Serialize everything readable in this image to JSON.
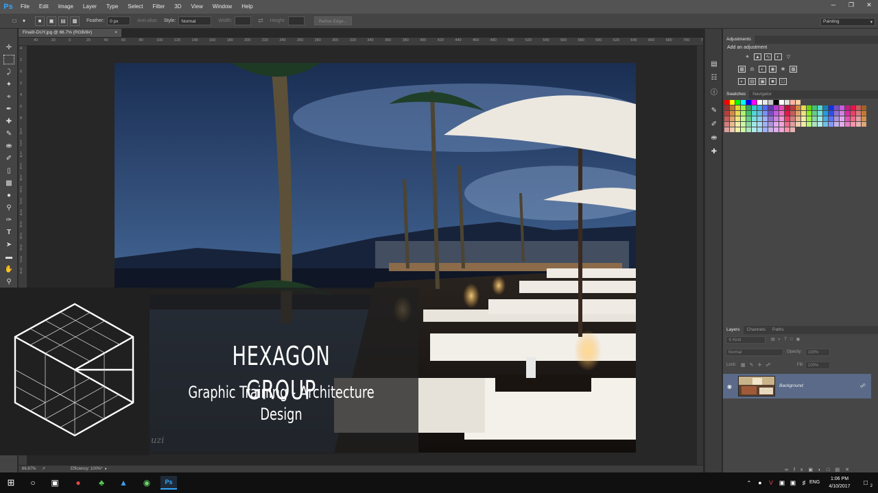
{
  "app": {
    "name": "Ps"
  },
  "menu": [
    "File",
    "Edit",
    "Image",
    "Layer",
    "Type",
    "Select",
    "Filter",
    "3D",
    "View",
    "Window",
    "Help"
  ],
  "options": {
    "feather_label": "Feather:",
    "feather_value": "0 px",
    "antialias_label": "Anti-alias",
    "style_label": "Style:",
    "style_value": "Normal",
    "width_label": "Width:",
    "height_label": "Height:",
    "refine_edge": "Refine Edge...",
    "workspace": "Painting"
  },
  "document": {
    "tab_title": "FinalII-DUY.jpg @ 66.7% (RGB/8#)",
    "close": "×",
    "zoom": "66.67%",
    "efficiency": "Efficiency: 100%*"
  },
  "ruler": {
    "top": [
      "40",
      "20",
      "0",
      "20",
      "40",
      "60",
      "80",
      "100",
      "120",
      "140",
      "160",
      "180",
      "200",
      "220",
      "240",
      "260",
      "280",
      "300",
      "320",
      "340",
      "360",
      "380",
      "400",
      "420",
      "440",
      "460",
      "480",
      "500",
      "520",
      "540",
      "560",
      "580",
      "600",
      "620",
      "640",
      "660",
      "680",
      "700",
      "720",
      "740"
    ],
    "left": [
      "4",
      "2",
      "0",
      "2",
      "4",
      "6",
      "8",
      "1 0",
      "1 2",
      "1 4",
      "1 6",
      "1 8",
      "2 0",
      "2 2",
      "2 4",
      "2 6",
      "2 8",
      "3 0",
      "3 2",
      "3 4"
    ]
  },
  "overlay": {
    "title": "HEXAGON GROUP",
    "subtitle": "Graphic Training - Architecture Design",
    "watermark": "uzi"
  },
  "adjustments": {
    "tab": "Adjustments",
    "add_label": "Add an adjustment"
  },
  "swatches": {
    "tabs": [
      "Swatches",
      "Navigator"
    ]
  },
  "layers": {
    "tabs": [
      "Layers",
      "Channels",
      "Paths"
    ],
    "kind": "Kind",
    "blend_mode": "Normal",
    "opacity_label": "Opacity:",
    "opacity_value": "100%",
    "lock_label": "Lock:",
    "fill_label": "Fill:",
    "fill_value": "100%",
    "layer_name": "Background"
  },
  "taskbar": {
    "language": "ENG",
    "time": "1:06 PM",
    "date": "4/10/2017",
    "notification_count": "2"
  },
  "colors": {
    "accent": "#31a8ff",
    "layer_selected": "#5a6a88",
    "panel": "#464646"
  }
}
